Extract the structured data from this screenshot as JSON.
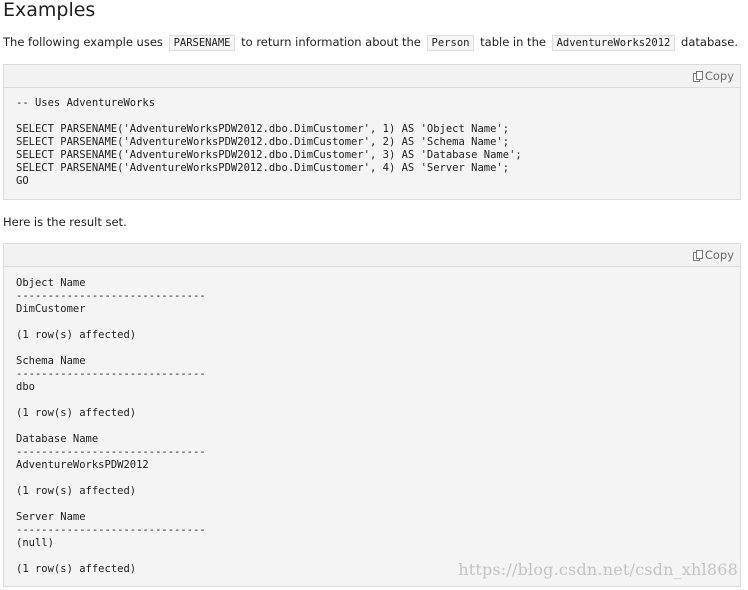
{
  "heading": "Examples",
  "intro": {
    "part1": "The following example uses ",
    "code1": "PARSENAME",
    "part2": " to return information about the ",
    "code2": "Person",
    "part3": " table in the ",
    "code3": "AdventureWorks2012",
    "part4": " database."
  },
  "code_block_1": {
    "copy_label": "Copy",
    "lines": [
      "-- Uses AdventureWorks",
      "",
      "SELECT PARSENAME('AdventureWorksPDW2012.dbo.DimCustomer', 1) AS 'Object Name';",
      "SELECT PARSENAME('AdventureWorksPDW2012.dbo.DimCustomer', 2) AS 'Schema Name';",
      "SELECT PARSENAME('AdventureWorksPDW2012.dbo.DimCustomer', 3) AS 'Database Name';",
      "SELECT PARSENAME('AdventureWorksPDW2012.dbo.DimCustomer', 4) AS 'Server Name';",
      "GO"
    ]
  },
  "result_intro": "Here is the result set.",
  "code_block_2": {
    "copy_label": "Copy",
    "lines": [
      "Object Name",
      "------------------------------",
      "DimCustomer",
      "",
      "(1 row(s) affected)",
      "",
      "Schema Name",
      "------------------------------",
      "dbo",
      "",
      "(1 row(s) affected)",
      "",
      "Database Name",
      "------------------------------",
      "AdventureWorksPDW2012",
      "",
      "(1 row(s) affected)",
      "",
      "Server Name",
      "------------------------------",
      "(null)",
      "",
      "(1 row(s) affected)"
    ]
  },
  "watermark": "https://blog.csdn.net/csdn_xhl868"
}
